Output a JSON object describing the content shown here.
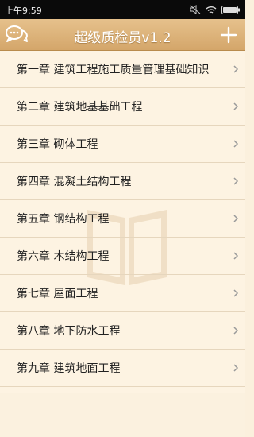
{
  "status_bar": {
    "time": "上午9:59"
  },
  "header": {
    "title": "超级质检员v1.2",
    "left_icon": "chat-bubbles-icon",
    "right_icon": "plus-icon"
  },
  "chapters": [
    {
      "label": "第一章  建筑工程施工质量管理基础知识"
    },
    {
      "label": "第二章  建筑地基基础工程"
    },
    {
      "label": "第三章  砌体工程"
    },
    {
      "label": "第四章  混凝土结构工程"
    },
    {
      "label": "第五章  钢结构工程"
    },
    {
      "label": "第六章 木结构工程"
    },
    {
      "label": "第七章 屋面工程"
    },
    {
      "label": "第八章  地下防水工程"
    },
    {
      "label": "第九章 建筑地面工程"
    }
  ],
  "colors": {
    "header": "#d9ad72",
    "background": "#fdf3e2",
    "divider": "#e6d6bd",
    "chevron": "#9a9a9a"
  }
}
